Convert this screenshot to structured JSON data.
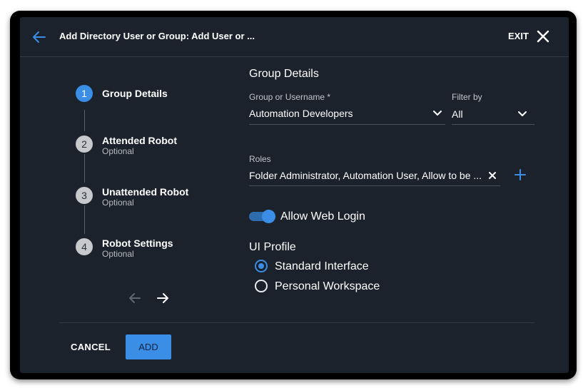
{
  "header": {
    "title": "Add Directory User or Group: Add User or ...",
    "exit_label": "EXIT"
  },
  "stepper": {
    "steps": [
      {
        "number": "1",
        "label": "Group Details",
        "sublabel": "",
        "active": true
      },
      {
        "number": "2",
        "label": "Attended Robot",
        "sublabel": "Optional",
        "active": false
      },
      {
        "number": "3",
        "label": "Unattended Robot",
        "sublabel": "Optional",
        "active": false
      },
      {
        "number": "4",
        "label": "Robot Settings",
        "sublabel": "Optional",
        "active": false
      }
    ]
  },
  "form": {
    "section_title": "Group Details",
    "group": {
      "label": "Group or Username *",
      "value": "Automation Developers"
    },
    "filter": {
      "label": "Filter by",
      "value": "All"
    },
    "roles": {
      "label": "Roles",
      "value": "Folder Administrator, Automation User, Allow to be ..."
    },
    "web_login": {
      "label": "Allow Web Login",
      "enabled": true
    },
    "ui_profile": {
      "title": "UI Profile",
      "options": [
        {
          "label": "Standard Interface",
          "selected": true
        },
        {
          "label": "Personal Workspace",
          "selected": false
        }
      ]
    }
  },
  "footer": {
    "cancel_label": "CANCEL",
    "add_label": "ADD"
  },
  "colors": {
    "accent": "#3a8ee6",
    "background": "#1b222b"
  }
}
